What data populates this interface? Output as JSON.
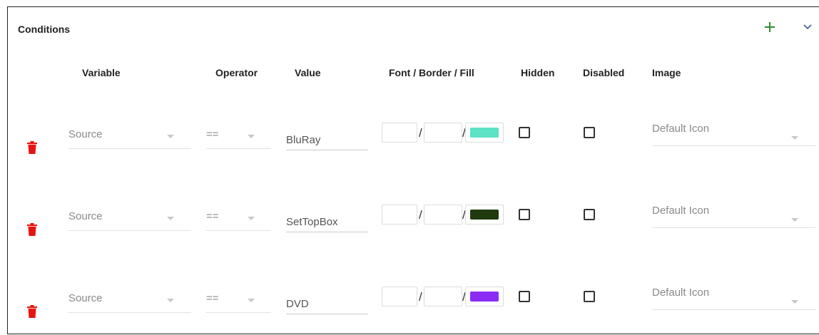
{
  "panel": {
    "title": "Conditions",
    "add_icon": "plus-icon",
    "collapse_icon": "chevron-down-icon"
  },
  "columns": {
    "variable": "Variable",
    "operator": "Operator",
    "value": "Value",
    "font_border_fill": "Font / Border / Fill",
    "hidden": "Hidden",
    "disabled": "Disabled",
    "image": "Image"
  },
  "separator": "/",
  "rows": [
    {
      "variable": "Source",
      "operator": "==",
      "value": "BluRay",
      "fill_color": "#5de2c6",
      "hidden": false,
      "disabled": false,
      "image": "Default Icon"
    },
    {
      "variable": "Source",
      "operator": "==",
      "value": "SetTopBox",
      "fill_color": "#1f3a0e",
      "hidden": false,
      "disabled": false,
      "image": "Default Icon"
    },
    {
      "variable": "Source",
      "operator": "==",
      "value": "DVD",
      "fill_color": "#8b2cf5",
      "hidden": false,
      "disabled": false,
      "image": "Default Icon"
    }
  ],
  "colors": {
    "delete_icon": "#e8140f",
    "add_icon": "#2e8b2e"
  }
}
